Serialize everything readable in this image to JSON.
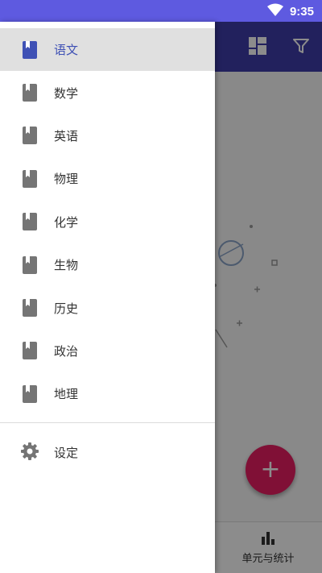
{
  "status_bar": {
    "time": "9:35",
    "wifi_icon": "wifi-icon"
  },
  "toolbar": {
    "layout_icon": "dashboard-icon",
    "filter_icon": "filter-icon"
  },
  "drawer": {
    "items": [
      {
        "label": "语文",
        "icon": "book-icon",
        "selected": true
      },
      {
        "label": "数学",
        "icon": "book-icon",
        "selected": false
      },
      {
        "label": "英语",
        "icon": "book-icon",
        "selected": false
      },
      {
        "label": "物理",
        "icon": "book-icon",
        "selected": false
      },
      {
        "label": "化学",
        "icon": "book-icon",
        "selected": false
      },
      {
        "label": "生物",
        "icon": "book-icon",
        "selected": false
      },
      {
        "label": "历史",
        "icon": "book-icon",
        "selected": false
      },
      {
        "label": "政治",
        "icon": "book-icon",
        "selected": false
      },
      {
        "label": "地理",
        "icon": "book-icon",
        "selected": false
      }
    ],
    "settings": {
      "label": "设定",
      "icon": "gear-icon"
    }
  },
  "fab": {
    "label": "+"
  },
  "bottom_nav": {
    "label": "单元与统计",
    "icon": "bar-chart-icon"
  },
  "colors": {
    "status_bar": "#5e5ae0",
    "app_bar": "#3f3ca9",
    "accent": "#3f51b5",
    "fab": "#e91e63",
    "icon_gray": "#757575"
  }
}
